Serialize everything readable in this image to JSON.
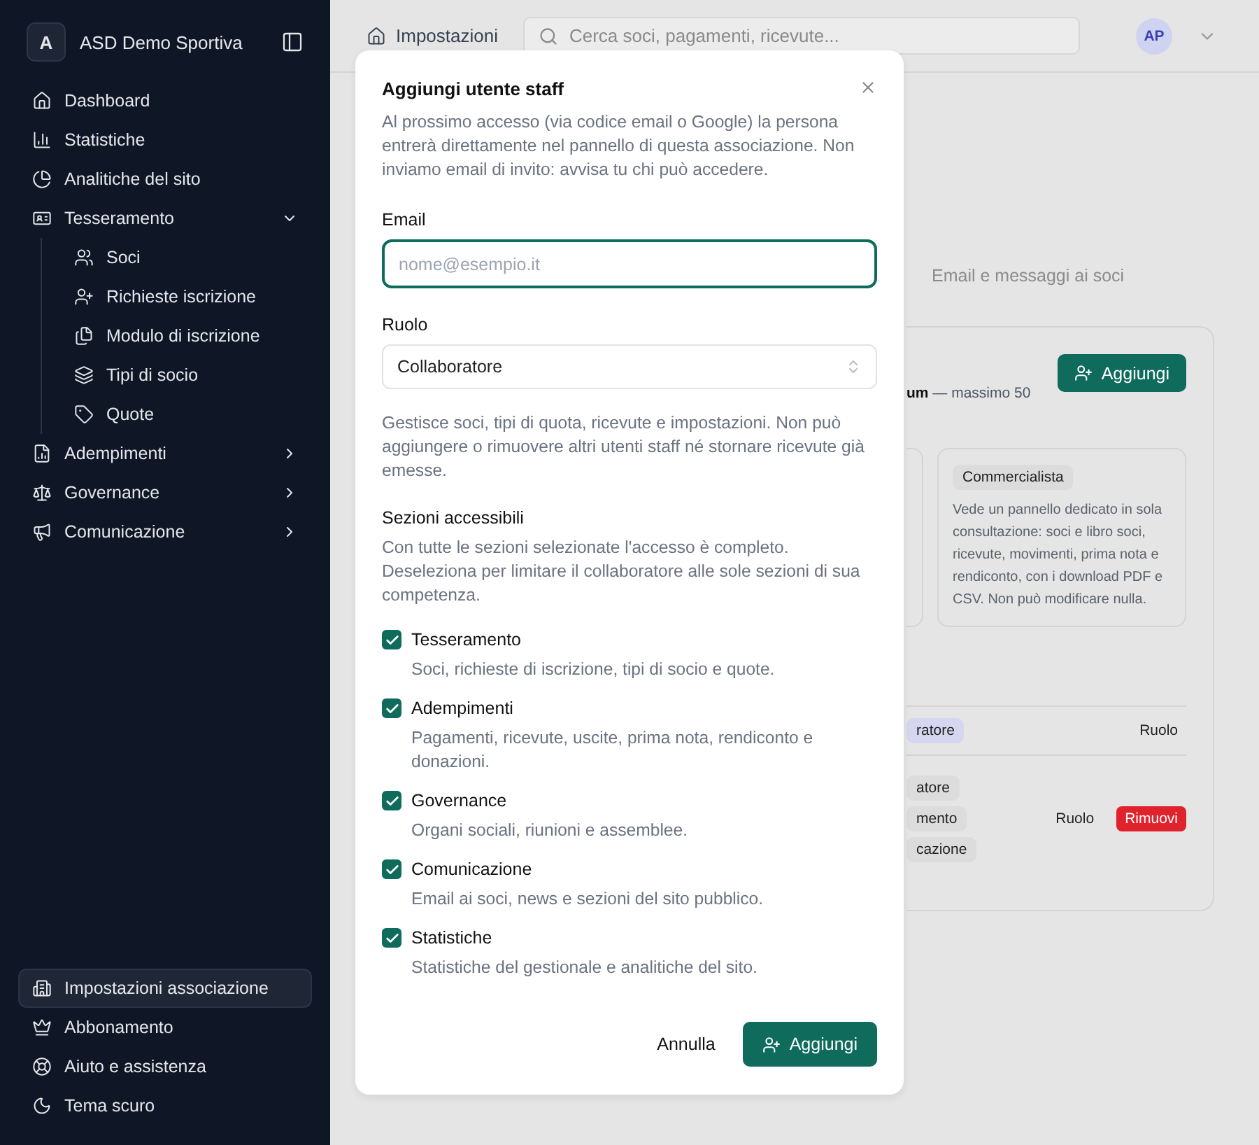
{
  "sidebar": {
    "brand": {
      "initial": "A",
      "name": "ASD Demo Sportiva"
    },
    "items": [
      {
        "label": "Dashboard"
      },
      {
        "label": "Statistiche"
      },
      {
        "label": "Analitiche del sito"
      },
      {
        "label": "Tesseramento",
        "expanded": true,
        "children": [
          {
            "label": "Soci"
          },
          {
            "label": "Richieste iscrizione"
          },
          {
            "label": "Modulo di iscrizione"
          },
          {
            "label": "Tipi di socio"
          },
          {
            "label": "Quote"
          }
        ]
      },
      {
        "label": "Adempimenti",
        "expanded": false
      },
      {
        "label": "Governance",
        "expanded": false
      },
      {
        "label": "Comunicazione",
        "expanded": false
      }
    ],
    "bottom_items": [
      {
        "label": "Impostazioni associazione",
        "selected": true
      },
      {
        "label": "Abbonamento",
        "selected": false
      },
      {
        "label": "Aiuto e assistenza",
        "selected": false
      },
      {
        "label": "Tema scuro",
        "selected": false
      }
    ]
  },
  "topbar": {
    "breadcrumb": "Impostazioni",
    "search": {
      "placeholder": "Cerca soci, pagamenti, ricevute..."
    },
    "avatar": "AP"
  },
  "background": {
    "tab": "Email e messaggi ai soci",
    "add_button": "Aggiungi",
    "limit": "**um** — massimo 50",
    "role_card": {
      "badge": "Commercialista",
      "text": "Vede un pannello dedicato in sola consultazione: soci e libro soci, ricevute, movimenti, prima nota e rendiconto, con i download PDF e CSV. Non può modificare nulla."
    },
    "rows": [
      {
        "badges": [
          {
            "text": "ratore",
            "color": "#d6d6f0"
          }
        ],
        "actions": [
          {
            "label": "Ruolo",
            "kind": "plain"
          }
        ]
      },
      {
        "badges": [
          {
            "text": "atore",
            "color": "#dcdcdc"
          },
          {
            "text": "mento",
            "color": "#dcdcdc"
          },
          {
            "text": "cazione",
            "color": "#dcdcdc"
          }
        ],
        "actions": [
          {
            "label": "Ruolo",
            "kind": "plain"
          },
          {
            "label": "Rimuovi",
            "kind": "danger"
          }
        ]
      }
    ]
  },
  "modal": {
    "title": "Aggiungi utente staff",
    "intro": "Al prossimo accesso (via codice email o Google) la persona entrerà direttamente nel pannello di questa associazione. Non inviamo email di invito: avvisa tu chi può accedere.",
    "email": {
      "label": "Email",
      "placeholder": "nome@esempio.it"
    },
    "role": {
      "label": "Ruolo",
      "value": "Collaboratore"
    },
    "role_description": "Gestisce soci, tipi di quota, ricevute e impostazioni. Non può aggiungere o rimuovere altri utenti staff né stornare ricevute già emesse.",
    "sections": {
      "title": "Sezioni accessibili",
      "description": "Con tutte le sezioni selezionate l'accesso è completo. Deseleziona per limitare il collaboratore alle sole sezioni di sua competenza.",
      "items": [
        {
          "label": "Tesseramento",
          "description": "Soci, richieste di iscrizione, tipi di socio e quote.",
          "checked": true
        },
        {
          "label": "Adempimenti",
          "description": "Pagamenti, ricevute, uscite, prima nota, rendiconto e donazioni.",
          "checked": true
        },
        {
          "label": "Governance",
          "description": "Organi sociali, riunioni e assemblee.",
          "checked": true
        },
        {
          "label": "Comunicazione",
          "description": "Email ai soci, news e sezioni del sito pubblico.",
          "checked": true
        },
        {
          "label": "Statistiche",
          "description": "Statistiche del gestionale e analitiche del sito.",
          "checked": true
        }
      ]
    },
    "cancel": "Annulla",
    "confirm": "Aggiungi"
  }
}
